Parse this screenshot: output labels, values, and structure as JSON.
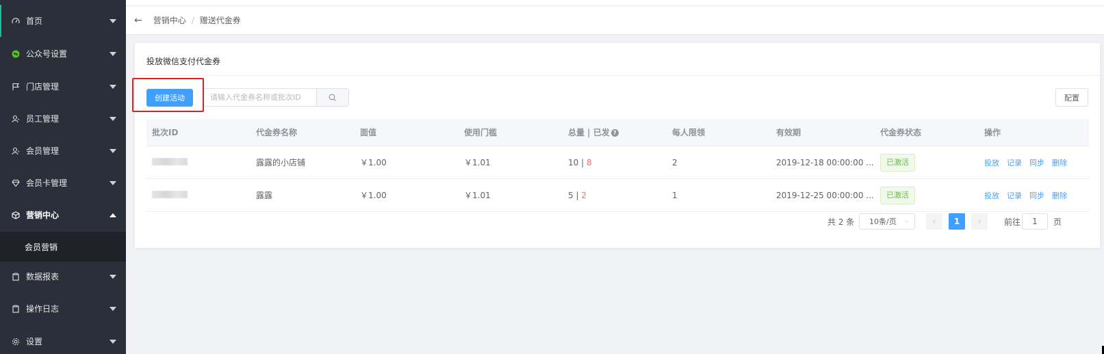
{
  "sidebar": {
    "items": [
      {
        "label": "首页",
        "icon": "dashboard-icon"
      },
      {
        "label": "公众号设置",
        "icon": "wechat-icon"
      },
      {
        "label": "门店管理",
        "icon": "flag-icon"
      },
      {
        "label": "员工管理",
        "icon": "user-icon"
      },
      {
        "label": "会员管理",
        "icon": "user-icon"
      },
      {
        "label": "会员卡管理",
        "icon": "diamond-icon"
      },
      {
        "label": "营销中心",
        "icon": "cube-icon"
      },
      {
        "label": "数据报表",
        "icon": "clipboard-icon"
      },
      {
        "label": "操作日志",
        "icon": "clipboard-icon"
      },
      {
        "label": "设置",
        "icon": "gear-icon"
      }
    ],
    "sub_item": "会员营销"
  },
  "breadcrumb": {
    "parent": "营销中心",
    "separator": "/",
    "current": "赠送代金券"
  },
  "card": {
    "title": "投放微信支付代金券",
    "create_button": "创建活动",
    "search_placeholder": "请输入代金券名称或批次ID",
    "config_button": "配置"
  },
  "table": {
    "headers": [
      "批次ID",
      "代金券名称",
      "面值",
      "使用门槛",
      "总量 | 已发",
      "每人限领",
      "有效期",
      "代金券状态",
      "操作"
    ],
    "rows": [
      {
        "name": "露露的小店铺",
        "face_value": "￥1.00",
        "threshold": "￥1.01",
        "total": "10",
        "sep": " | ",
        "issued": "8",
        "limit": "2",
        "validity": "2019-12-18 00:00:00 ...",
        "status": "已激活"
      },
      {
        "name": "露露",
        "face_value": "￥1.00",
        "threshold": "￥1.01",
        "total": "5",
        "sep": " | ",
        "issued": "2",
        "limit": "1",
        "validity": "2019-12-25 00:00:00 ...",
        "status": "已激活"
      }
    ],
    "actions": [
      "投放",
      "记录",
      "同步",
      "删除"
    ]
  },
  "pagination": {
    "total": "共 2 条",
    "page_size": "10条/页",
    "current_page": "1",
    "goto_label": "前往",
    "goto_value": "1",
    "page_suffix": "页"
  },
  "colors": {
    "sidebar_bg": "#2b2f3a",
    "primary": "#409eff",
    "highlight": "#e02020",
    "success": "#67c23a",
    "danger": "#f56c6c"
  }
}
